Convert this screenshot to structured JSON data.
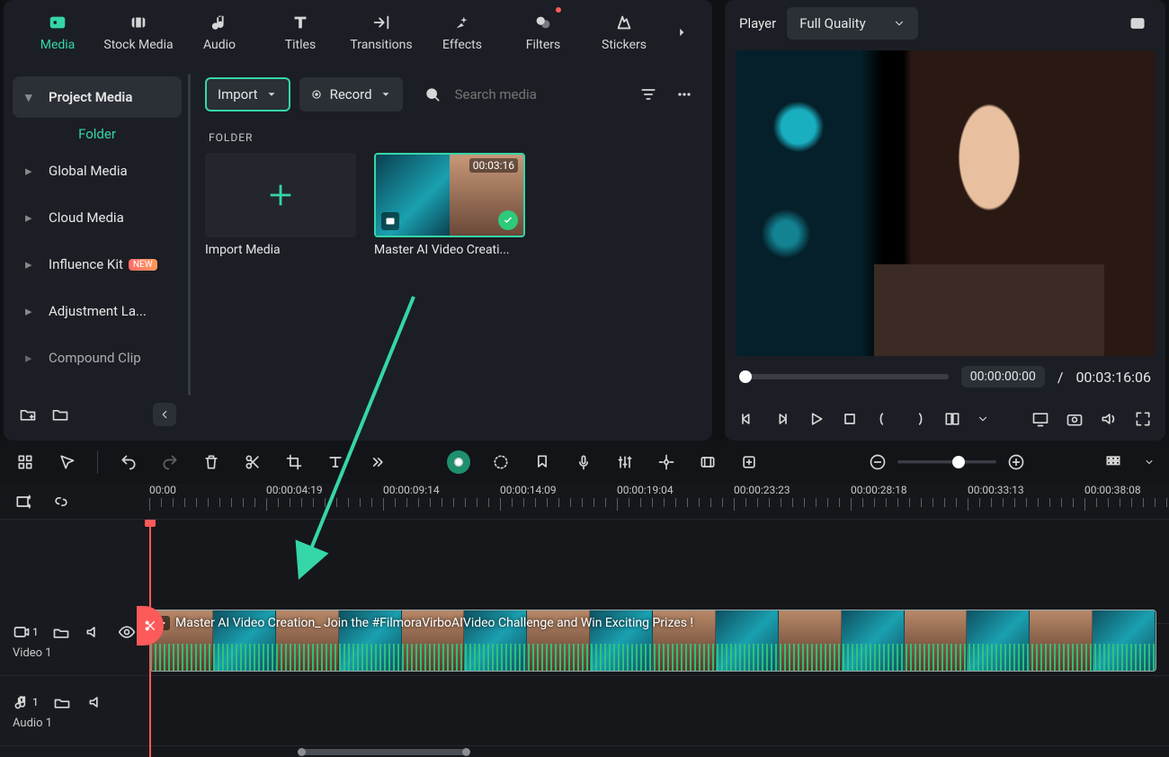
{
  "tabs": {
    "media": "Media",
    "stock": "Stock Media",
    "audio": "Audio",
    "titles": "Titles",
    "transitions": "Transitions",
    "effects": "Effects",
    "filters": "Filters",
    "stickers": "Stickers"
  },
  "sidebar": {
    "project_media": "Project Media",
    "folder": "Folder",
    "global_media": "Global Media",
    "cloud_media": "Cloud Media",
    "influence_kit": "Influence Kit",
    "influence_badge": "NEW",
    "adjustment": "Adjustment La...",
    "compound": "Compound Clip"
  },
  "toolbar": {
    "import": "Import",
    "record": "Record",
    "search_placeholder": "Search media"
  },
  "folder": {
    "label": "FOLDER",
    "import_caption": "Import Media",
    "clip_caption": "Master AI Video Creati...",
    "clip_duration": "00:03:16"
  },
  "player": {
    "label": "Player",
    "quality": "Full Quality",
    "current_time": "00:00:00:00",
    "separator": "/",
    "total_time": "00:03:16:06"
  },
  "ruler": {
    "t0": "00:00",
    "t1": "00:00:04:19",
    "t2": "00:00:09:14",
    "t3": "00:00:14:09",
    "t4": "00:00:19:04",
    "t5": "00:00:23:23",
    "t6": "00:00:28:18",
    "t7": "00:00:33:13",
    "t8": "00:00:38:08"
  },
  "tracks": {
    "video_badge": "1",
    "video_name": "Video 1",
    "audio_badge": "1",
    "audio_name": "Audio 1",
    "clip_title": "Master AI Video Creation_ Join the #FilmoraVirboAIVideo Challenge and Win Exciting Prizes !"
  }
}
